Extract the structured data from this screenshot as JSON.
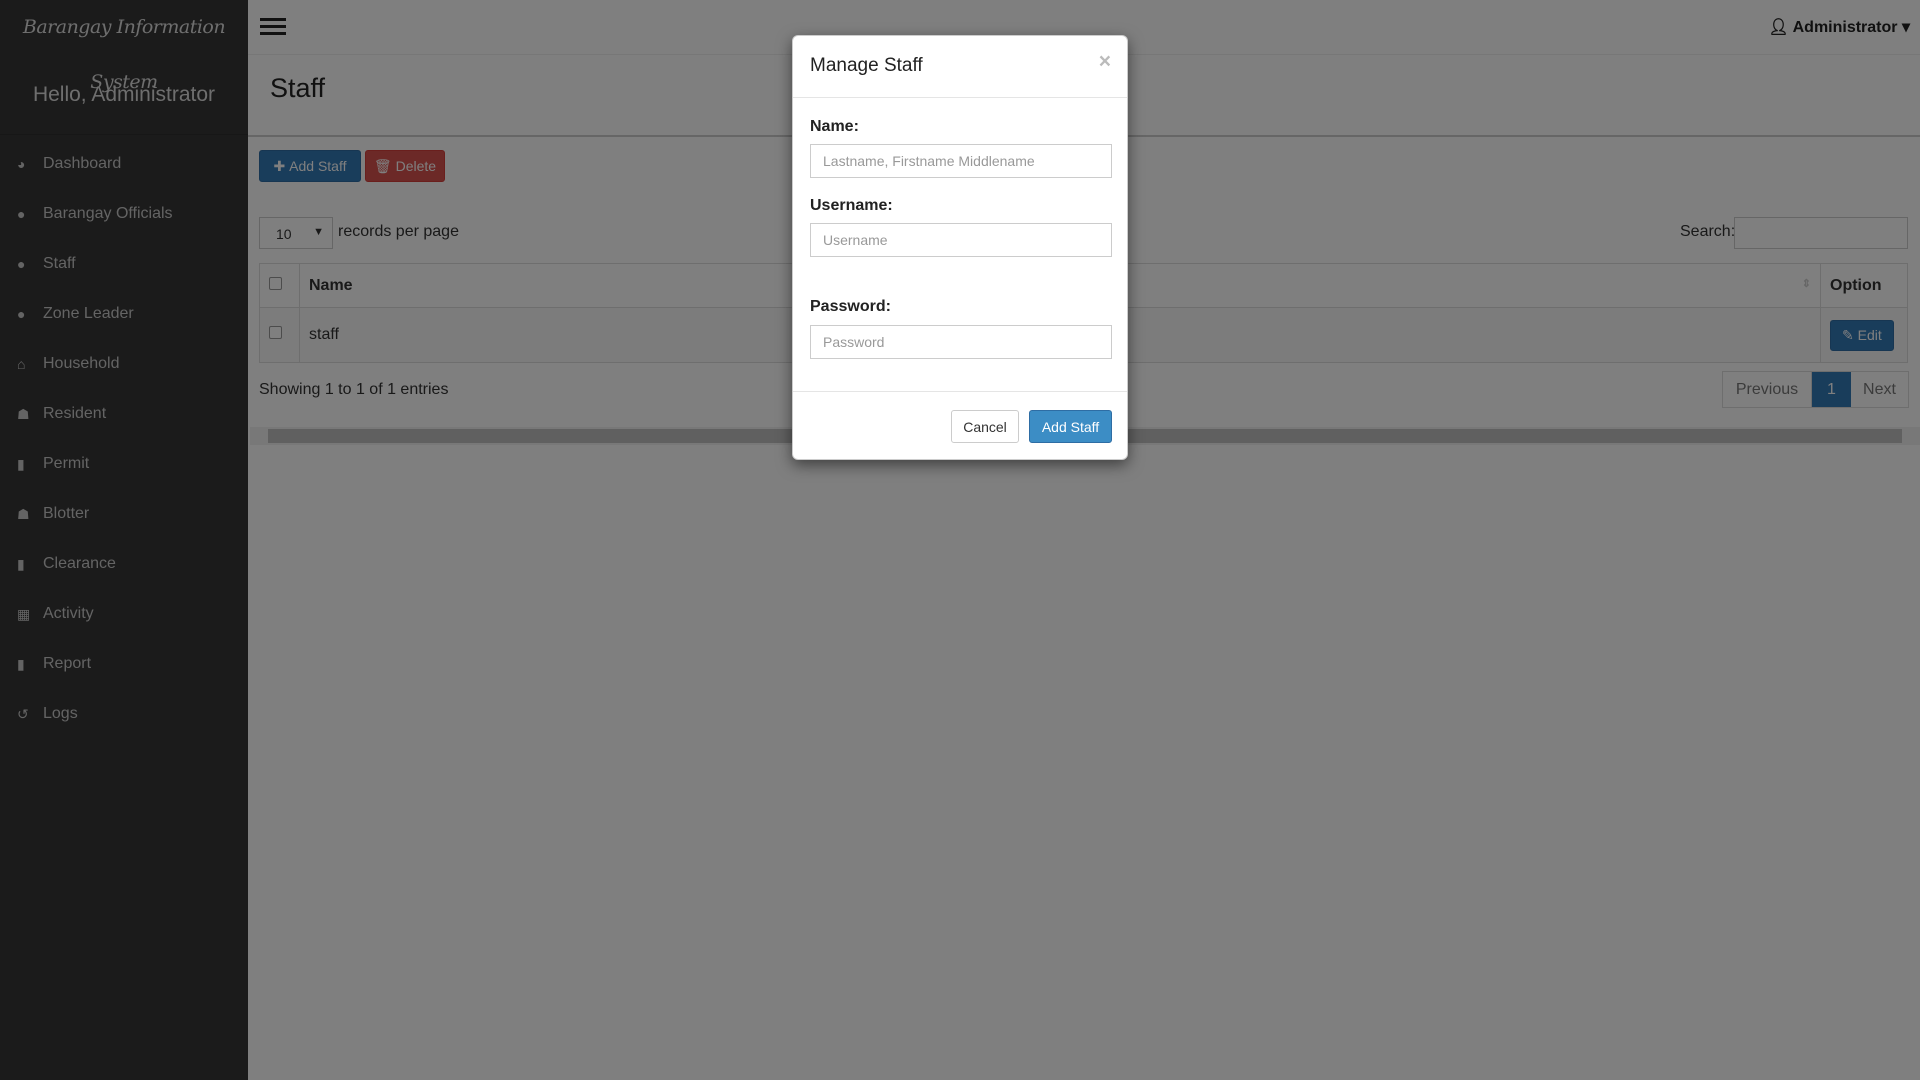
{
  "sidebar": {
    "brand": "Barangay Information System",
    "greeting": "Hello, Administrator",
    "items": [
      {
        "label": "Dashboard",
        "icon": "dashboard-icon",
        "glyph": "◕"
      },
      {
        "label": "Barangay Officials",
        "icon": "user-icon",
        "glyph": "●"
      },
      {
        "label": "Staff",
        "icon": "user-icon",
        "glyph": "●"
      },
      {
        "label": "Zone Leader",
        "icon": "user-icon",
        "glyph": "●"
      },
      {
        "label": "Household",
        "icon": "home-icon",
        "glyph": "⌂"
      },
      {
        "label": "Resident",
        "icon": "users-icon",
        "glyph": "☗"
      },
      {
        "label": "Permit",
        "icon": "file-icon",
        "glyph": "▮"
      },
      {
        "label": "Blotter",
        "icon": "users-icon",
        "glyph": "☗"
      },
      {
        "label": "Clearance",
        "icon": "file-icon",
        "glyph": "▮"
      },
      {
        "label": "Activity",
        "icon": "calendar-icon",
        "glyph": "▦"
      },
      {
        "label": "Report",
        "icon": "file-icon",
        "glyph": "▮"
      },
      {
        "label": "Logs",
        "icon": "history-icon",
        "glyph": "↺"
      }
    ]
  },
  "topbar": {
    "user": "Administrator"
  },
  "page": {
    "title": "Staff",
    "add_label": "Add Staff",
    "delete_label": "Delete",
    "length_value": "10",
    "length_suffix": "records per page",
    "search_label": "Search:",
    "columns": [
      "Name",
      "Option"
    ],
    "rows": [
      {
        "name": "staff",
        "action": "Edit"
      }
    ],
    "info": "Showing 1 to 1 of 1 entries",
    "pager": {
      "prev": "Previous",
      "current": "1",
      "next": "Next"
    }
  },
  "modal": {
    "title": "Manage Staff",
    "close": "×",
    "name_label": "Name:",
    "name_placeholder": "Lastname, Firstname Middlename",
    "username_label": "Username:",
    "username_placeholder": "Username",
    "password_label": "Password:",
    "password_placeholder": "Password",
    "cancel": "Cancel",
    "submit": "Add Staff"
  },
  "colors": {
    "primary": "#337ab7",
    "danger": "#d9534f",
    "sidebar": "#363636"
  }
}
